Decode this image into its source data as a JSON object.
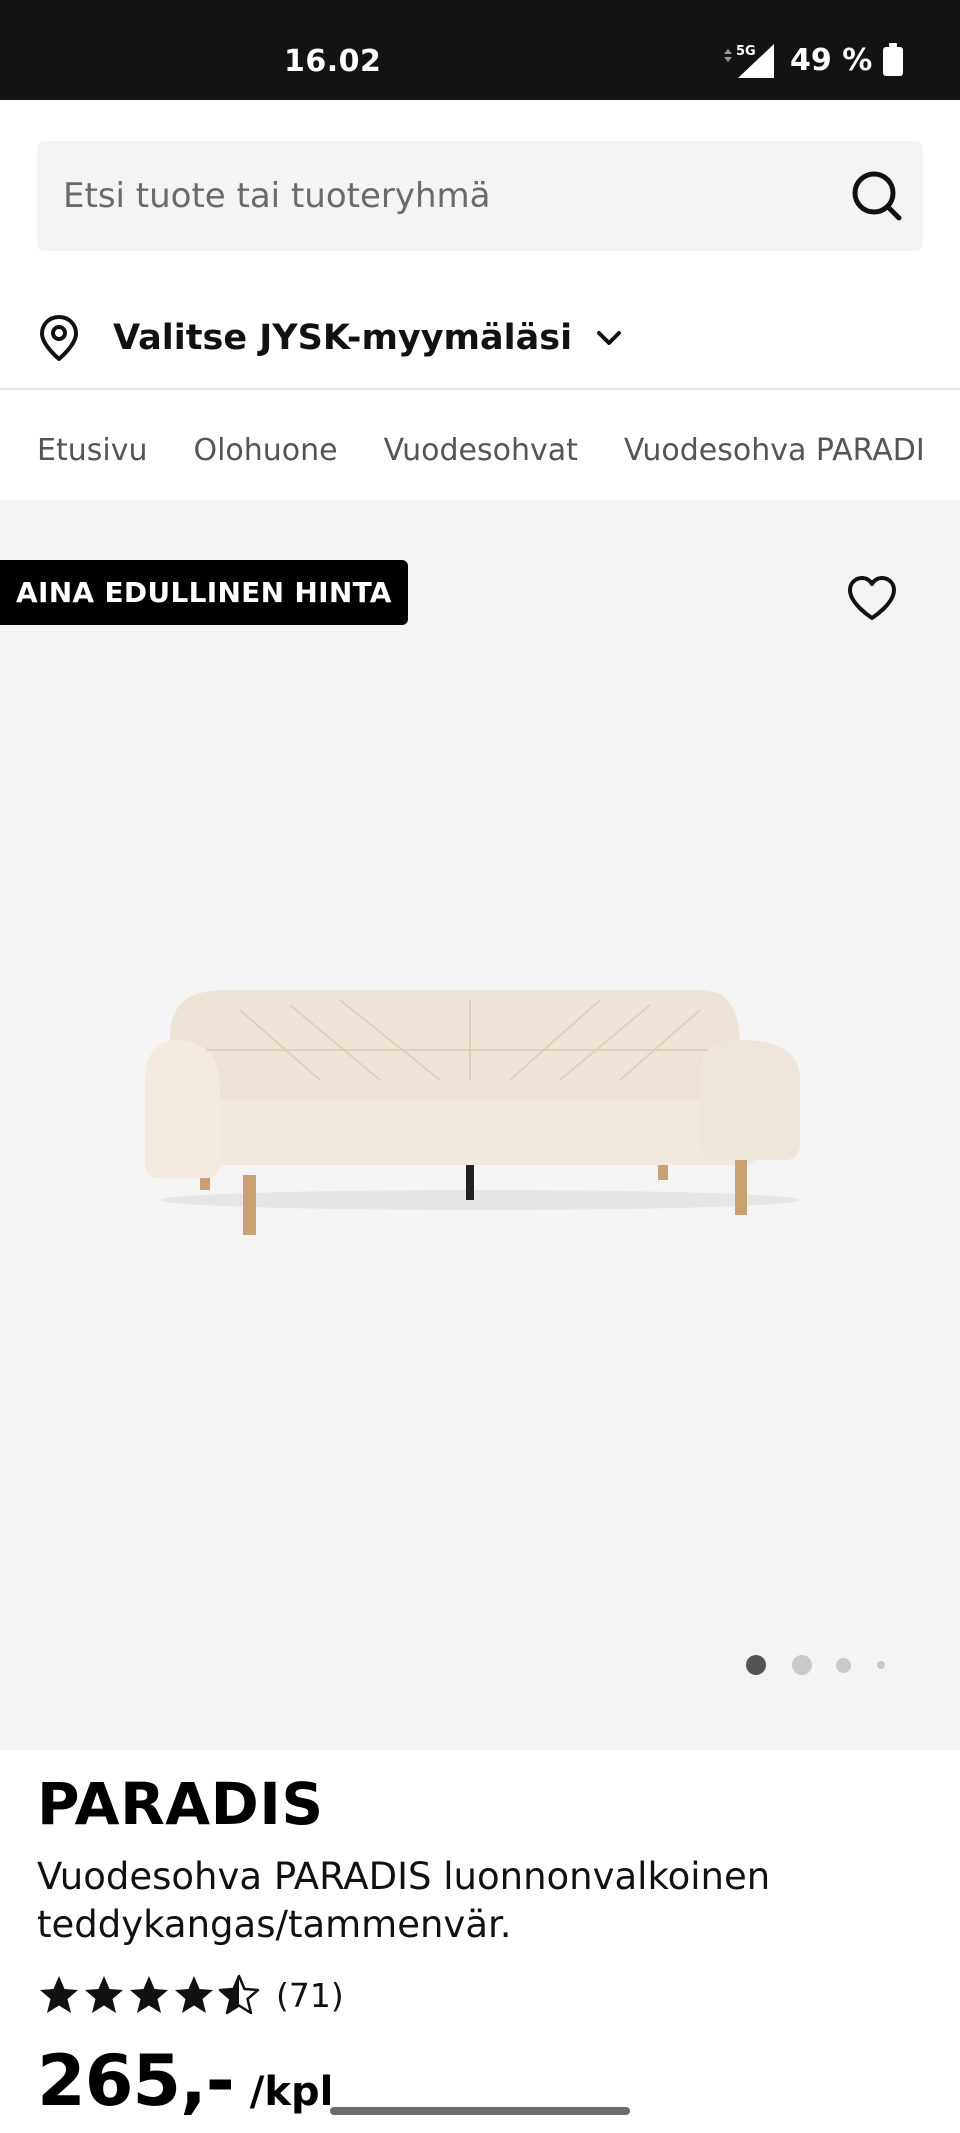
{
  "status_bar": {
    "time": "16.02",
    "network": "5G",
    "battery": "49 %"
  },
  "search": {
    "placeholder": "Etsi tuote tai tuoteryhmä",
    "icon": "search-icon"
  },
  "store_selector": {
    "label": "Valitse JYSK-myymäläsi",
    "icon": "map-pin-icon"
  },
  "breadcrumb": [
    "Etusivu",
    "Olohuone",
    "Vuodesohvat",
    "Vuodesohva PARADIS"
  ],
  "gallery": {
    "badge": "AINA EDULLINEN HINTA",
    "image_count": 4,
    "active_index": 0
  },
  "product": {
    "brand": "PARADIS",
    "name": "Vuodesohva PARADIS luonnonvalkoinen teddykangas/tammenvär.",
    "rating": 4.5,
    "review_count": "(71)",
    "price": "265,-",
    "unit": "/kpl"
  },
  "colors": {
    "status_bar": "#131313",
    "gallery_bg": "#f4f4f4",
    "badge_bg": "#000000",
    "text": "#111111"
  }
}
